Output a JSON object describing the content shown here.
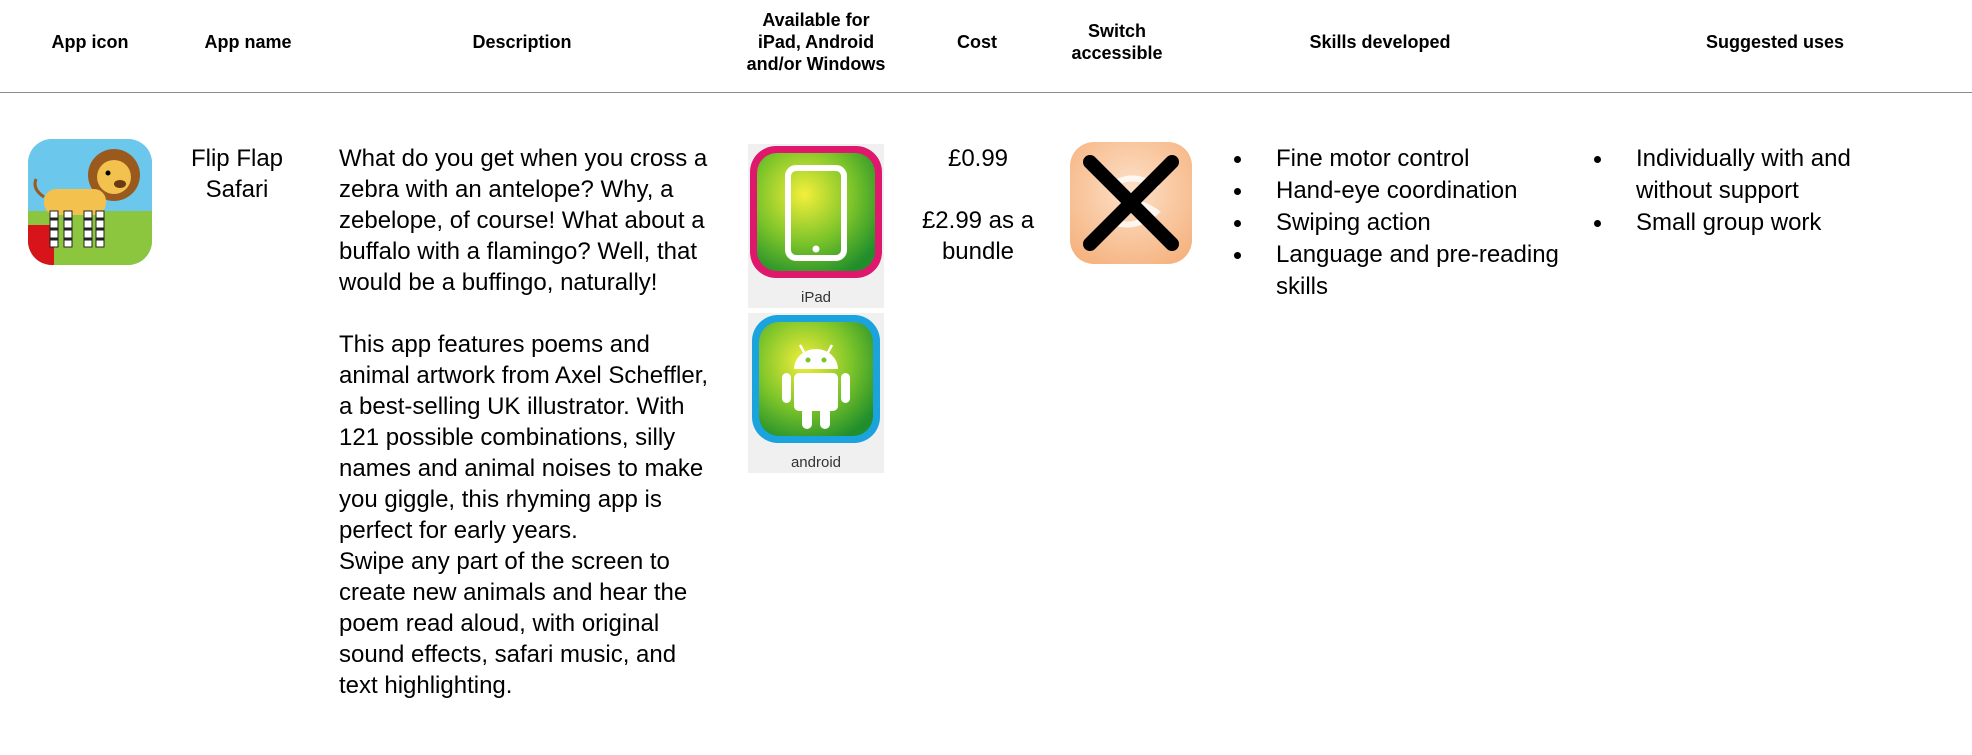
{
  "headers": {
    "app_icon": "App icon",
    "app_name": "App name",
    "description": "Description",
    "available": "Available for\niPad, Android\nand/or Windows",
    "cost": "Cost",
    "switch": "Switch\naccessible",
    "skills": "Skills developed",
    "uses": "Suggested uses"
  },
  "row": {
    "app_name": "Flip Flap Safari",
    "description": [
      "What do you get when you cross a zebra with an antelope? Why, a zebelope, of course! What about a buffalo with a flamingo? Well, that would be a buffingo, naturally!",
      "This app features poems and animal artwork from Axel Scheffler, a best-selling UK illustrator. With 121 possible combinations, silly names and animal noises to make you giggle, this rhyming app is perfect for early years.",
      "Swipe any part of the screen to create new animals and hear the poem read aloud, with original sound effects, safari music, and text highlighting."
    ],
    "platforms": [
      "iPad",
      "android"
    ],
    "cost_single": "£0.99",
    "cost_bundle": "£2.99 as a bundle",
    "skills": [
      "Fine motor control",
      "Hand-eye coordination",
      "Swiping action",
      "Language and pre-reading skills"
    ],
    "uses": [
      "Individually with and without support",
      "Small group work"
    ]
  },
  "icons": {
    "app_icon": "lion-zebra-app-icon",
    "ipad": "ipad-platform-icon",
    "android": "android-platform-icon",
    "switch": "not-switch-accessible-icon"
  },
  "colors": {
    "header_rule": "#8c8c8c",
    "ipad_frame": "#e0186d",
    "android_frame": "#1aa3dd",
    "badge_green": "#4caf1f"
  }
}
